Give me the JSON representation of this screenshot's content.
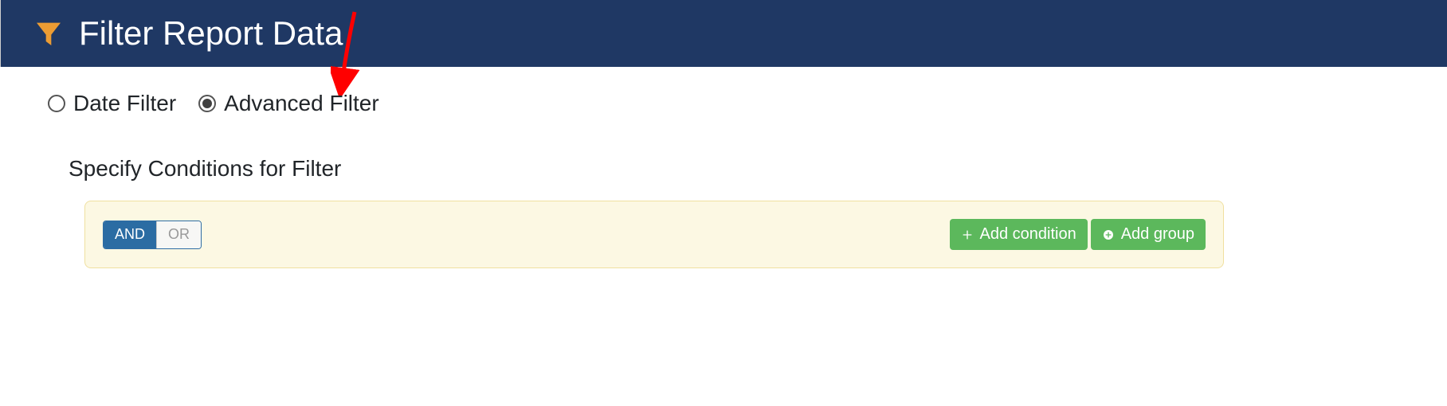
{
  "header": {
    "title": "Filter Report Data"
  },
  "filter_mode": {
    "options": [
      {
        "label": "Date Filter",
        "selected": false
      },
      {
        "label": "Advanced Filter",
        "selected": true
      }
    ]
  },
  "section": {
    "heading": "Specify Conditions for Filter"
  },
  "logic_toggle": {
    "and_label": "AND",
    "or_label": "OR",
    "active": "AND"
  },
  "buttons": {
    "add_condition": "Add condition",
    "add_group": "Add group"
  },
  "colors": {
    "header_bg": "#1f3864",
    "panel_bg": "#fcf8e3",
    "btn_green": "#5cb85c",
    "toggle_active": "#2b6ca3",
    "funnel": "#ec9c33",
    "arrow": "#ff0000"
  }
}
